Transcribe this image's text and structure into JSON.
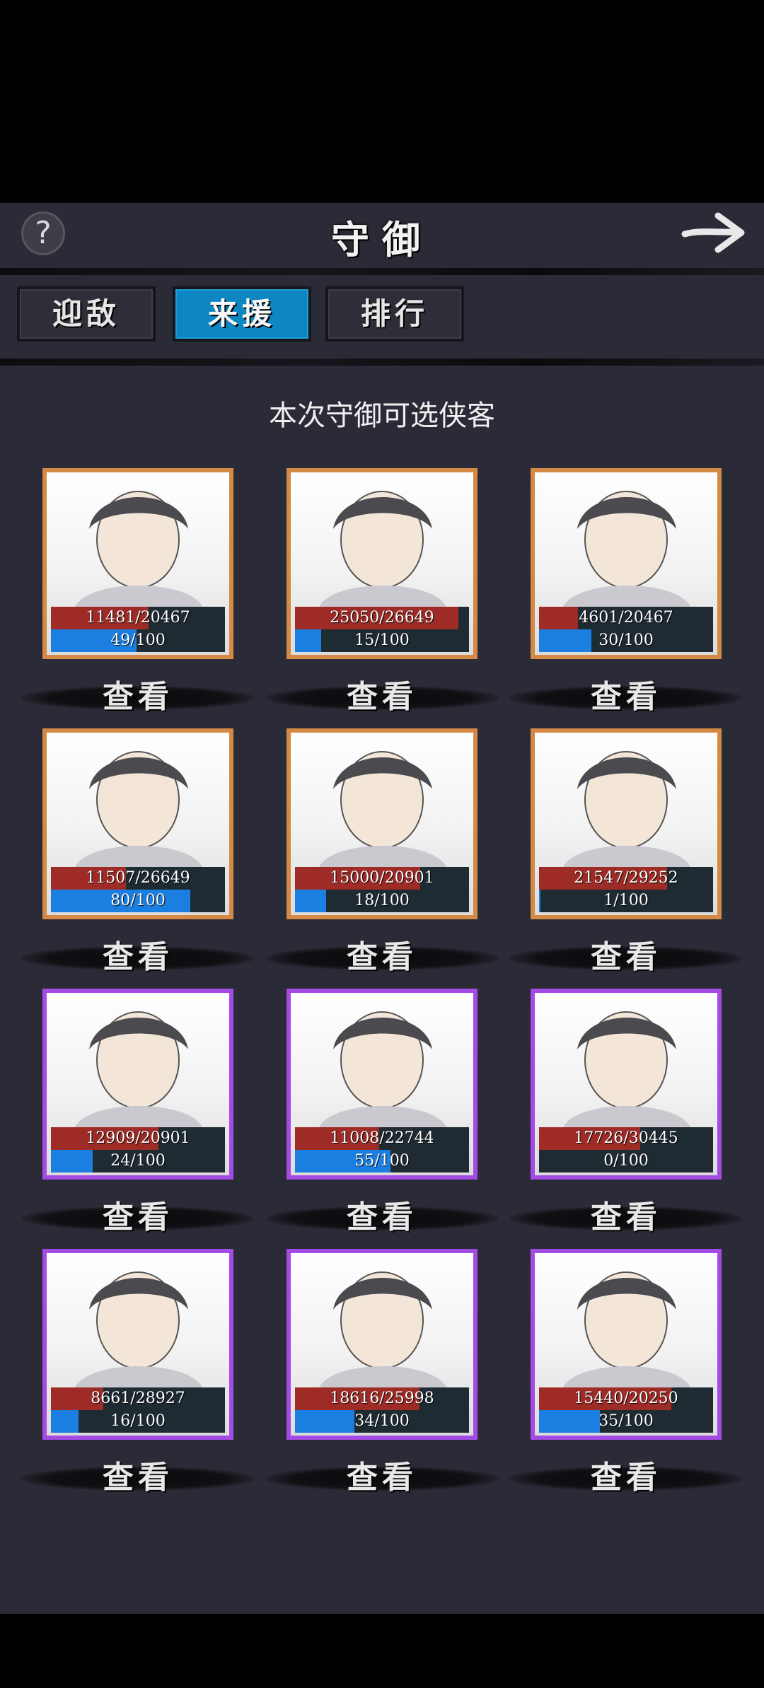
{
  "header": {
    "title": "守御"
  },
  "tabs": [
    {
      "label": "迎敌",
      "active": false
    },
    {
      "label": "来援",
      "active": true
    },
    {
      "label": "排行",
      "active": false
    }
  ],
  "subtitle": "本次守御可选侠客",
  "view_label": "查看",
  "colors": {
    "gold_frame": "#d48945",
    "purple_frame": "#a44be6",
    "hp": "#9e2b26",
    "exp": "#1b7fe2",
    "tab_active": "#0e86c1"
  },
  "heroes": [
    {
      "hp": "11481/20467",
      "exp": "49/100",
      "hp_ratio": 0.561,
      "exp_ratio": 0.49,
      "frame": "gold"
    },
    {
      "hp": "25050/26649",
      "exp": "15/100",
      "hp_ratio": 0.94,
      "exp_ratio": 0.15,
      "frame": "gold"
    },
    {
      "hp": "4601/20467",
      "exp": "30/100",
      "hp_ratio": 0.225,
      "exp_ratio": 0.3,
      "frame": "gold"
    },
    {
      "hp": "11507/26649",
      "exp": "80/100",
      "hp_ratio": 0.432,
      "exp_ratio": 0.8,
      "frame": "gold"
    },
    {
      "hp": "15000/20901",
      "exp": "18/100",
      "hp_ratio": 0.718,
      "exp_ratio": 0.18,
      "frame": "gold"
    },
    {
      "hp": "21547/29252",
      "exp": "1/100",
      "hp_ratio": 0.737,
      "exp_ratio": 0.01,
      "frame": "gold"
    },
    {
      "hp": "12909/20901",
      "exp": "24/100",
      "hp_ratio": 0.618,
      "exp_ratio": 0.24,
      "frame": "purple"
    },
    {
      "hp": "11008/22744",
      "exp": "55/100",
      "hp_ratio": 0.484,
      "exp_ratio": 0.55,
      "frame": "purple"
    },
    {
      "hp": "17726/30445",
      "exp": "0/100",
      "hp_ratio": 0.582,
      "exp_ratio": 0.0,
      "frame": "purple"
    },
    {
      "hp": "8661/28927",
      "exp": "16/100",
      "hp_ratio": 0.299,
      "exp_ratio": 0.16,
      "frame": "purple"
    },
    {
      "hp": "18616/25998",
      "exp": "34/100",
      "hp_ratio": 0.716,
      "exp_ratio": 0.34,
      "frame": "purple"
    },
    {
      "hp": "15440/20250",
      "exp": "35/100",
      "hp_ratio": 0.762,
      "exp_ratio": 0.35,
      "frame": "purple"
    }
  ]
}
